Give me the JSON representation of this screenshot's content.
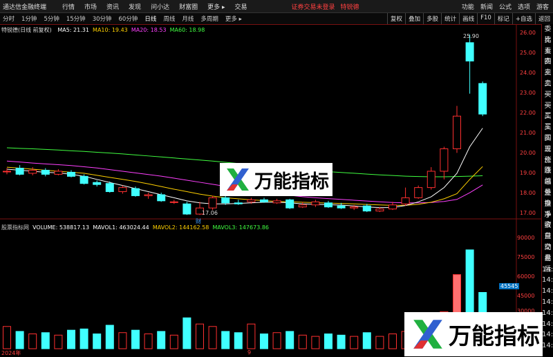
{
  "app": {
    "title": "通达信金融终端",
    "menu": [
      "行情",
      "市场",
      "资讯",
      "发现",
      "问小达",
      "财富圈",
      "更多 ▸",
      "交易"
    ],
    "login_status": "证券交易未登录",
    "stock_name": "特锐德",
    "right_menu": [
      "功能",
      "新闻",
      "公式",
      "选项",
      "游客"
    ]
  },
  "toolbar": {
    "periods": [
      "分时",
      "1分钟",
      "5分钟",
      "15分钟",
      "30分钟",
      "60分钟",
      "日线",
      "周线",
      "月线",
      "多周期",
      "更多 ▸"
    ],
    "active_period": "日线",
    "right_buttons": [
      "复权",
      "叠加",
      "多股",
      "统计",
      "画线",
      "F10",
      "标记",
      "+自选",
      "返回"
    ]
  },
  "chart_legend": {
    "title": "特锐德(日线 前复权)",
    "ma5": "MA5: 21.31",
    "ma10": "MA10: 19.43",
    "ma20": "MA20: 18.53",
    "ma60": "MA60: 18.98"
  },
  "volume_legend": {
    "title": "股票指标网",
    "volume": "VOLUME: 538817.13",
    "mavol1": "MAVOL1: 463024.44",
    "mavol2": "MAVOL2: 144162.58",
    "mavol3": "MAVOL3: 147673.86"
  },
  "side_panel": [
    "委比",
    "卖五",
    "卖四",
    "卖三",
    "卖二",
    "卖一",
    "买一",
    "买二",
    "买三",
    "买四",
    "买五",
    "现价",
    "涨跌",
    "涨幅",
    "总量",
    "外盘",
    "换手",
    "净资",
    "收益",
    "自动",
    "交易",
    "盘后",
    "14:56",
    "14:56",
    "14:56",
    "14:56",
    "14:56",
    "14:56",
    "14:57",
    "14:57"
  ],
  "price_axis": [
    "26.00",
    "25.00",
    "24.00",
    "23.00",
    "22.00",
    "21.00",
    "20.00",
    "19.00",
    "18.00",
    "17.00"
  ],
  "volume_axis": [
    "90000",
    "75000",
    "60000",
    "45000",
    "30000"
  ],
  "annotations": {
    "high": "25.90",
    "low": "17.06",
    "event": "财"
  },
  "x_axis": {
    "start": "2024年",
    "mid": "9"
  },
  "watermark": "万能指标",
  "highlight_vol": "45545",
  "colors": {
    "up": "#ff3030",
    "down": "#40ffff",
    "ma5": "#ffffff",
    "ma10": "#ffd000",
    "ma20": "#ff40ff",
    "ma60": "#40ff40"
  },
  "chart_data": {
    "type": "candlestick",
    "y_range": [
      17.0,
      26.0
    ],
    "candles": [
      {
        "o": 19.2,
        "c": 19.2,
        "h": 19.35,
        "l": 19.05
      },
      {
        "o": 19.35,
        "c": 19.05,
        "h": 19.5,
        "l": 19.0
      },
      {
        "o": 19.1,
        "c": 19.25,
        "h": 19.4,
        "l": 19.0
      },
      {
        "o": 19.25,
        "c": 19.05,
        "h": 19.35,
        "l": 18.95
      },
      {
        "o": 19.05,
        "c": 19.2,
        "h": 19.3,
        "l": 19.0
      },
      {
        "o": 19.15,
        "c": 18.95,
        "h": 19.25,
        "l": 18.9
      },
      {
        "o": 18.95,
        "c": 18.6,
        "h": 19.05,
        "l": 18.55
      },
      {
        "o": 18.65,
        "c": 18.55,
        "h": 18.75,
        "l": 18.45
      },
      {
        "o": 18.6,
        "c": 18.2,
        "h": 18.7,
        "l": 18.15
      },
      {
        "o": 18.2,
        "c": 18.4,
        "h": 18.5,
        "l": 18.1
      },
      {
        "o": 18.35,
        "c": 18.0,
        "h": 18.45,
        "l": 17.95
      },
      {
        "o": 18.0,
        "c": 18.05,
        "h": 18.15,
        "l": 17.85
      },
      {
        "o": 18.05,
        "c": 17.75,
        "h": 18.15,
        "l": 17.7
      },
      {
        "o": 17.7,
        "c": 17.7,
        "h": 17.8,
        "l": 17.6
      },
      {
        "o": 17.6,
        "c": 17.1,
        "h": 17.7,
        "l": 17.06
      },
      {
        "o": 17.1,
        "c": 17.4,
        "h": 17.7,
        "l": 17.06
      },
      {
        "o": 17.4,
        "c": 17.9,
        "h": 18.0,
        "l": 17.3
      },
      {
        "o": 17.9,
        "c": 17.65,
        "h": 18.0,
        "l": 17.55
      },
      {
        "o": 17.65,
        "c": 17.6,
        "h": 17.8,
        "l": 17.55
      },
      {
        "o": 17.7,
        "c": 17.8,
        "h": 17.9,
        "l": 17.6
      },
      {
        "o": 17.8,
        "c": 17.7,
        "h": 17.9,
        "l": 17.65
      },
      {
        "o": 17.65,
        "c": 17.75,
        "h": 17.85,
        "l": 17.6
      },
      {
        "o": 17.8,
        "c": 17.4,
        "h": 17.85,
        "l": 17.35
      },
      {
        "o": 17.45,
        "c": 17.55,
        "h": 17.7,
        "l": 17.4
      },
      {
        "o": 17.55,
        "c": 17.7,
        "h": 17.8,
        "l": 17.45
      },
      {
        "o": 17.65,
        "c": 17.45,
        "h": 17.75,
        "l": 17.4
      },
      {
        "o": 17.5,
        "c": 17.4,
        "h": 17.65,
        "l": 17.35
      },
      {
        "o": 17.4,
        "c": 17.45,
        "h": 17.55,
        "l": 17.3
      },
      {
        "o": 17.5,
        "c": 17.25,
        "h": 17.6,
        "l": 17.2
      },
      {
        "o": 17.25,
        "c": 17.35,
        "h": 17.45,
        "l": 17.2
      },
      {
        "o": 17.35,
        "c": 17.55,
        "h": 17.7,
        "l": 17.3
      },
      {
        "o": 17.6,
        "c": 17.9,
        "h": 18.4,
        "l": 17.5
      },
      {
        "o": 17.9,
        "c": 18.4,
        "h": 18.5,
        "l": 17.85
      },
      {
        "o": 18.4,
        "c": 19.2,
        "h": 19.4,
        "l": 18.3
      },
      {
        "o": 19.2,
        "c": 20.3,
        "h": 20.4,
        "l": 18.8
      },
      {
        "o": 20.3,
        "c": 21.9,
        "h": 22.4,
        "l": 20.1
      },
      {
        "o": 25.5,
        "c": 24.6,
        "h": 25.9,
        "l": 23.0
      },
      {
        "o": 23.5,
        "c": 22.0,
        "h": 23.6,
        "l": 21.9
      }
    ],
    "ma5": [
      19.3,
      19.25,
      19.2,
      19.15,
      19.12,
      19.05,
      18.95,
      18.8,
      18.65,
      18.5,
      18.35,
      18.2,
      18.05,
      17.9,
      17.75,
      17.65,
      17.6,
      17.6,
      17.62,
      17.65,
      17.68,
      17.68,
      17.65,
      17.6,
      17.58,
      17.56,
      17.54,
      17.5,
      17.45,
      17.42,
      17.42,
      17.52,
      17.7,
      17.95,
      18.4,
      19.1,
      20.4,
      21.31
    ],
    "ma10": [
      19.4,
      19.35,
      19.3,
      19.25,
      19.2,
      19.15,
      19.1,
      19.0,
      18.9,
      18.8,
      18.7,
      18.58,
      18.45,
      18.32,
      18.2,
      18.08,
      17.98,
      17.9,
      17.85,
      17.8,
      17.76,
      17.72,
      17.7,
      17.68,
      17.66,
      17.64,
      17.62,
      17.6,
      17.57,
      17.55,
      17.53,
      17.53,
      17.58,
      17.68,
      17.85,
      18.1,
      18.8,
      19.43
    ],
    "ma20": [
      19.7,
      19.65,
      19.6,
      19.56,
      19.52,
      19.48,
      19.42,
      19.36,
      19.28,
      19.2,
      19.12,
      19.04,
      18.96,
      18.86,
      18.76,
      18.66,
      18.56,
      18.46,
      18.36,
      18.26,
      18.18,
      18.1,
      18.02,
      17.95,
      17.9,
      17.86,
      17.82,
      17.78,
      17.74,
      17.7,
      17.67,
      17.65,
      17.65,
      17.67,
      17.72,
      17.82,
      18.15,
      18.53
    ],
    "ma60": [
      20.35,
      20.32,
      20.3,
      20.27,
      20.24,
      20.2,
      20.17,
      20.13,
      20.09,
      20.05,
      20.0,
      19.95,
      19.9,
      19.85,
      19.8,
      19.75,
      19.7,
      19.64,
      19.58,
      19.52,
      19.46,
      19.4,
      19.34,
      19.28,
      19.23,
      19.18,
      19.14,
      19.1,
      19.06,
      19.02,
      18.99,
      18.96,
      18.94,
      18.93,
      18.93,
      18.94,
      18.96,
      18.98
    ],
    "volumes": [
      18000,
      14000,
      12000,
      13000,
      11000,
      15000,
      16000,
      12000,
      19000,
      13000,
      15000,
      12000,
      14000,
      11000,
      25000,
      20000,
      18000,
      14000,
      13000,
      20000,
      12000,
      13000,
      14000,
      11000,
      10000,
      12000,
      11000,
      10000,
      13000,
      10000,
      12000,
      14000,
      16000,
      22000,
      30000,
      60000,
      80000,
      45545
    ]
  }
}
